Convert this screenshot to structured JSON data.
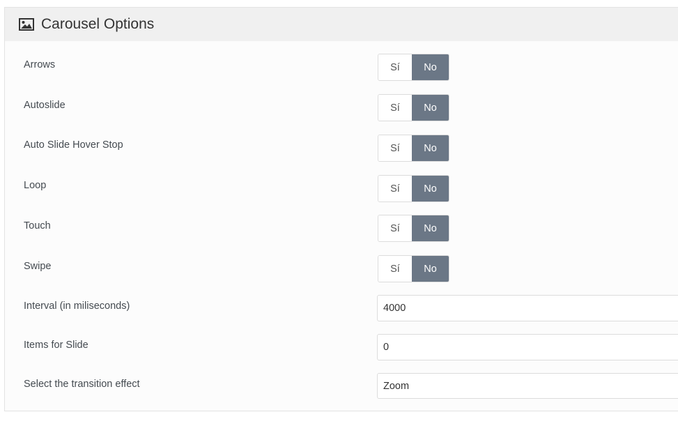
{
  "panel": {
    "title": "Carousel Options",
    "icon": "image-icon"
  },
  "toggles": [
    {
      "label": "Arrows",
      "yes": "Sí",
      "no": "No",
      "selected": "No"
    },
    {
      "label": "Autoslide",
      "yes": "Sí",
      "no": "No",
      "selected": "No"
    },
    {
      "label": "Auto Slide Hover Stop",
      "yes": "Sí",
      "no": "No",
      "selected": "No"
    },
    {
      "label": "Loop",
      "yes": "Sí",
      "no": "No",
      "selected": "No"
    },
    {
      "label": "Touch",
      "yes": "Sí",
      "no": "No",
      "selected": "No"
    },
    {
      "label": "Swipe",
      "yes": "Sí",
      "no": "No",
      "selected": "No"
    }
  ],
  "fields": [
    {
      "label": "Interval (in miliseconds)",
      "value": "4000"
    },
    {
      "label": "Items for Slide",
      "value": "0"
    },
    {
      "label": "Select the transition effect",
      "value": "Zoom"
    }
  ],
  "colors": {
    "selected_bg": "#6b7786",
    "header_bg": "#f0f0f0"
  }
}
